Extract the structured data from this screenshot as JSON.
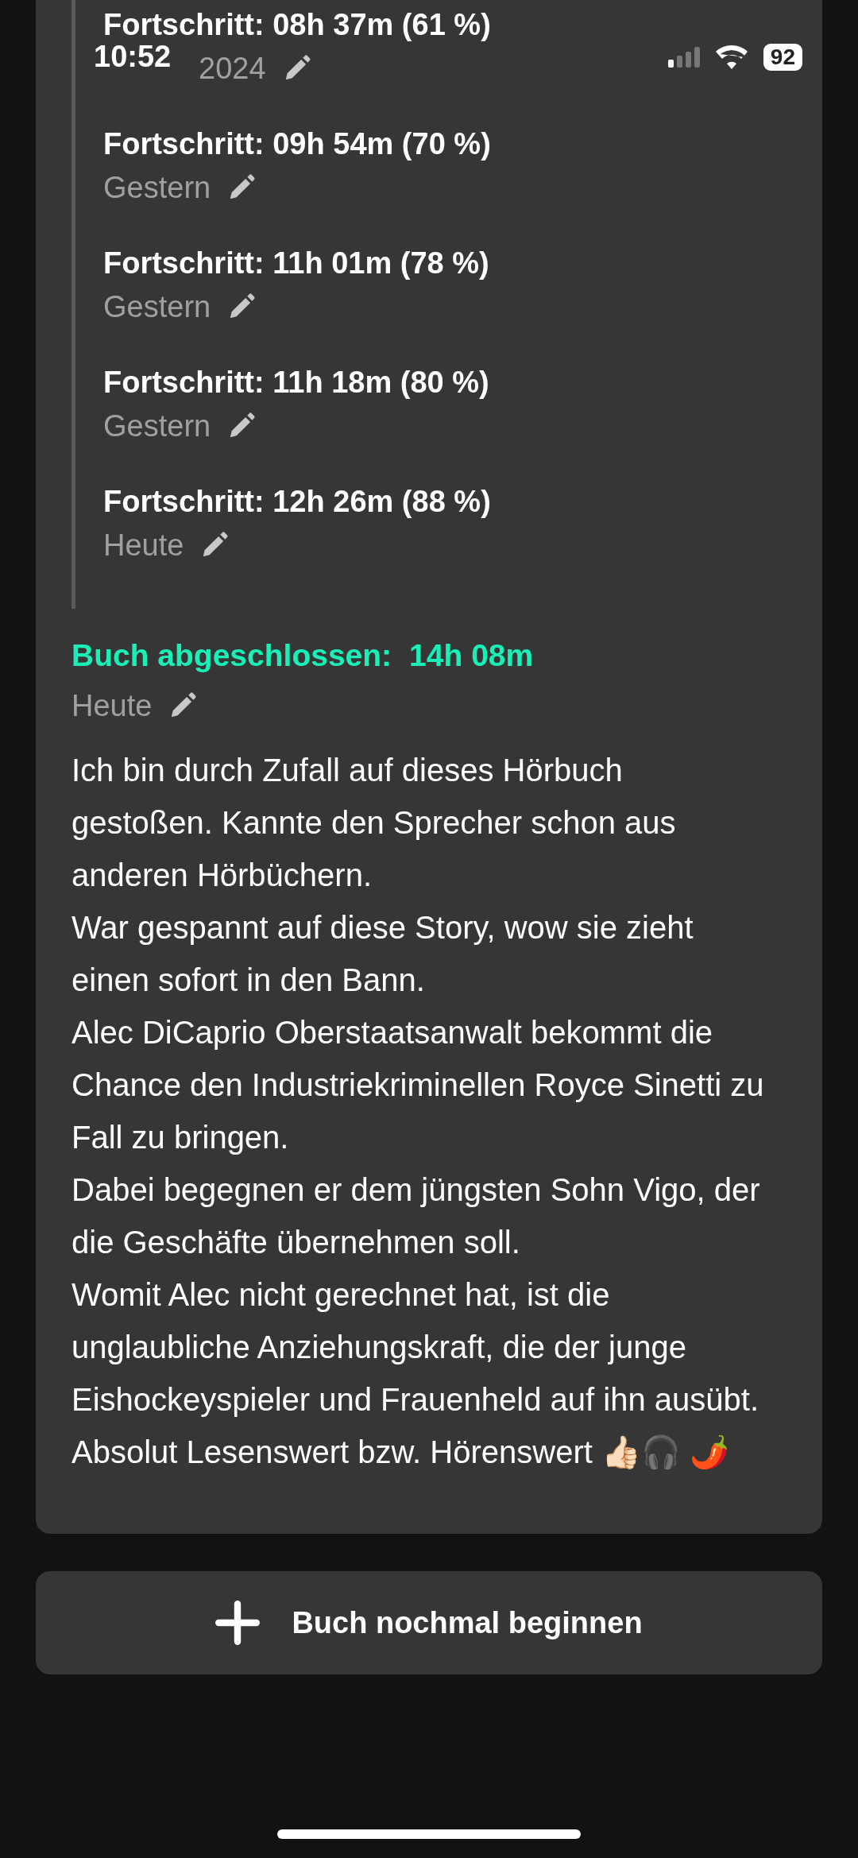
{
  "status_bar": {
    "time": "10:52",
    "battery": "92"
  },
  "progress_entries": [
    {
      "title": "Fortschritt: 08h 37m (61 %)",
      "date": "2024"
    },
    {
      "title": "Fortschritt: 09h 54m (70 %)",
      "date": "Gestern"
    },
    {
      "title": "Fortschritt: 11h 01m (78 %)",
      "date": "Gestern"
    },
    {
      "title": "Fortschritt: 11h 18m (80 %)",
      "date": "Gestern"
    },
    {
      "title": "Fortschritt: 12h 26m (88 %)",
      "date": "Heute"
    }
  ],
  "finished": {
    "label": "Buch abgeschlossen:",
    "duration": "14h 08m",
    "date": "Heute"
  },
  "review": [
    "Ich bin durch Zufall auf dieses Hörbuch gestoßen. Kannte den Sprecher schon aus anderen Hörbüchern.",
    "War gespannt auf diese Story, wow sie zieht einen sofort in den Bann.",
    "Alec DiCaprio Oberstaatsanwalt bekommt die Chance den Industriekriminellen Royce Sinetti zu Fall zu bringen.",
    "Dabei begegnen er dem jüngsten Sohn Vigo, der die Geschäfte übernehmen soll.",
    "Womit Alec nicht gerechnet hat, ist die unglaubliche Anziehungskraft, die der junge Eishockeyspieler und Frauenheld auf ihn ausübt.",
    "Absolut Lesenswert bzw. Hörenswert 👍🏻🎧 🌶️"
  ],
  "restart_button": {
    "label": "Buch nochmal beginnen"
  }
}
